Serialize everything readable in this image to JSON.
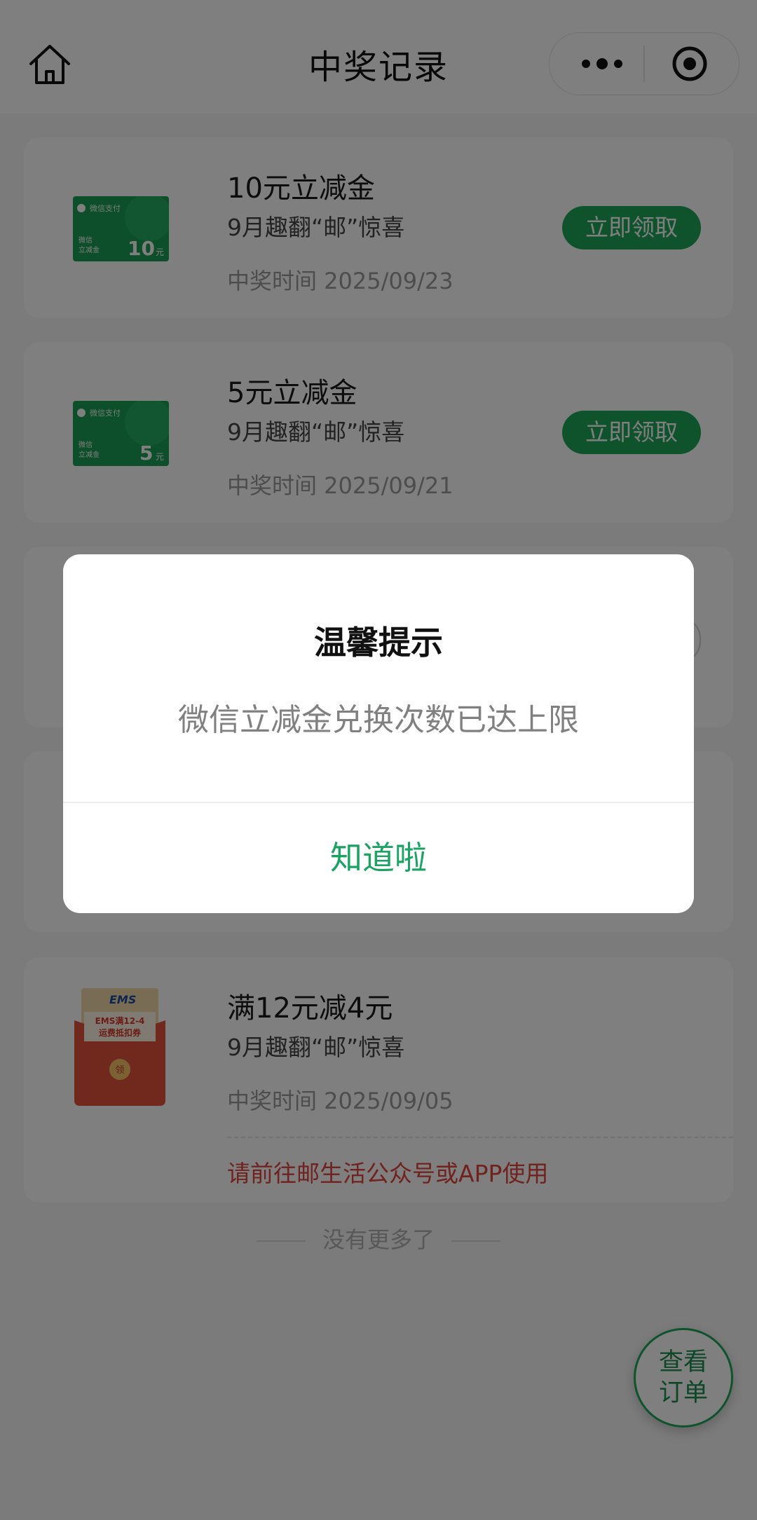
{
  "header": {
    "title": "中奖记录"
  },
  "records": [
    {
      "title": "10元立减金",
      "subtitle": "9月趣翻“邮”惊喜",
      "time": "中奖时间 2025/09/23",
      "action": "立即领取",
      "thumb_amount": "10",
      "thumb_unit": "元",
      "thumb_brand": "微信支付",
      "thumb_label1": "微信",
      "thumb_label2": "立减金"
    },
    {
      "title": "5元立减金",
      "subtitle": "9月趣翻“邮”惊喜",
      "time": "中奖时间 2025/09/21",
      "action": "立即领取",
      "thumb_amount": "5",
      "thumb_unit": "元",
      "thumb_brand": "微信支付",
      "thumb_label1": "微信",
      "thumb_label2": "立减金"
    },
    {
      "title": "满12元减4元",
      "subtitle": "9月趣翻“邮”惊喜",
      "time": "中奖时间 2025/09/05",
      "note": "请前往邮生活公众号或APP使用",
      "ems_logo": "EMS",
      "ems_line1": "EMS满12-4",
      "ems_line2": "运费抵扣券",
      "ems_stamp": "领"
    }
  ],
  "footer": {
    "no_more": "没有更多了"
  },
  "float_button": {
    "line1": "查看",
    "line2": "订单"
  },
  "modal": {
    "title": "温馨提示",
    "message": "微信立减金兑换次数已达上限",
    "confirm": "知道啦"
  },
  "colors": {
    "accent": "#1ea65a",
    "note_red": "#e0443c",
    "mask": "rgba(0,0,0,0.5)"
  },
  "icons": {
    "home": "home-icon",
    "more": "more-icon",
    "close": "target-icon"
  }
}
